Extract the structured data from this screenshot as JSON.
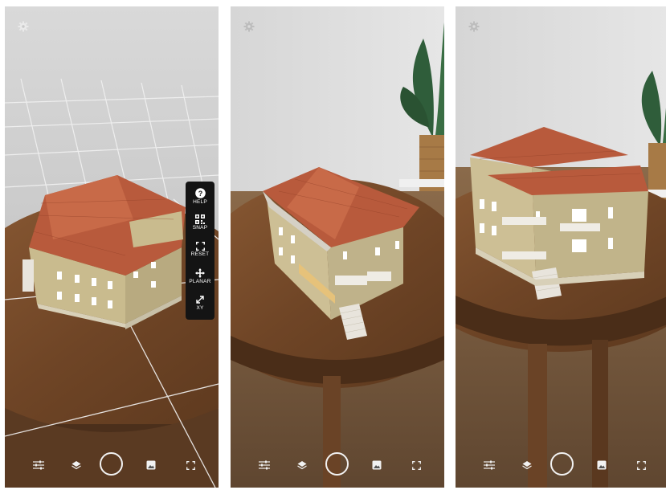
{
  "ar_toolbar": {
    "items": [
      {
        "label": "HELP",
        "icon": "help-circle-icon"
      },
      {
        "label": "SNAP",
        "icon": "qr-code-icon"
      },
      {
        "label": "RESET",
        "icon": "reset-frame-icon"
      },
      {
        "label": "PLANAR",
        "icon": "move-cross-icon"
      },
      {
        "label": "XY",
        "icon": "xy-resize-icon"
      }
    ]
  },
  "bottom_bar": {
    "icons": [
      "sliders-icon",
      "layers-icon",
      "shutter-button",
      "photo-icon",
      "fullscreen-icon"
    ]
  },
  "top_icon": "settings-gear-icon",
  "colors": {
    "toolbar_bg": "#141414",
    "roof": "#b85a3c",
    "wall": "#cdbf95",
    "table": "#6e4425"
  }
}
